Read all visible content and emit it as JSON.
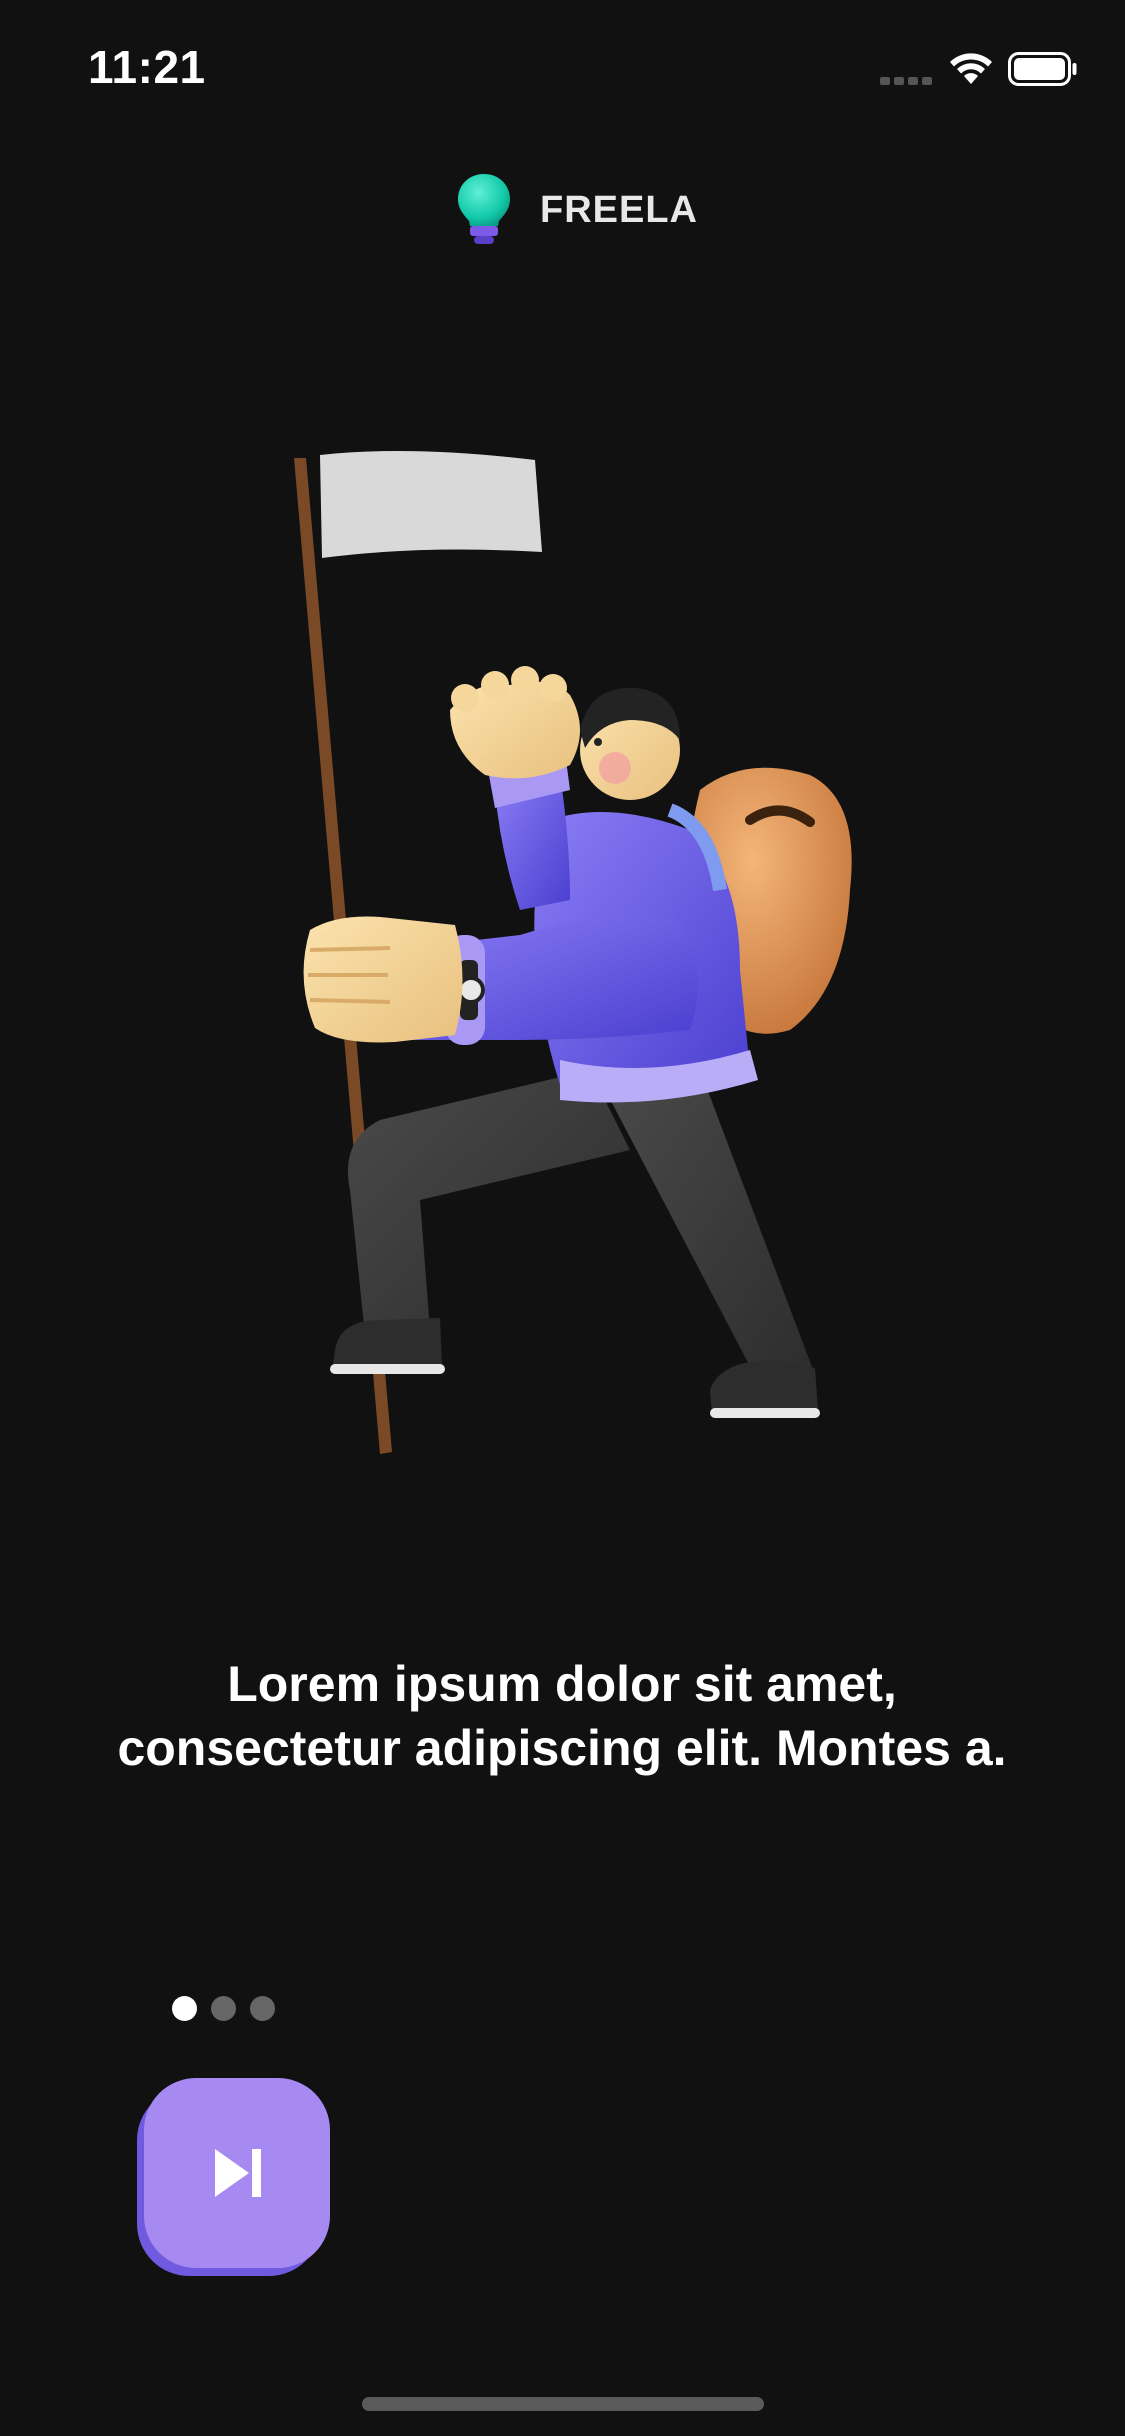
{
  "status_bar": {
    "time": "11:21"
  },
  "brand": {
    "name": "FREELA",
    "icon": "lightbulb-icon"
  },
  "onboarding": {
    "headline": "Lorem ipsum dolor sit amet, consectetur adipiscing elit. Montes a.",
    "illustration": "hiker-with-flag-illustration",
    "page_count": 3,
    "current_page": 1
  },
  "skip_button": {
    "icon": "skip-next-icon"
  },
  "colors": {
    "background": "#111111",
    "accent": "#a68af2",
    "accent_shadow": "#6f5ae0",
    "dot_inactive": "#666666",
    "dot_active": "#ffffff"
  }
}
